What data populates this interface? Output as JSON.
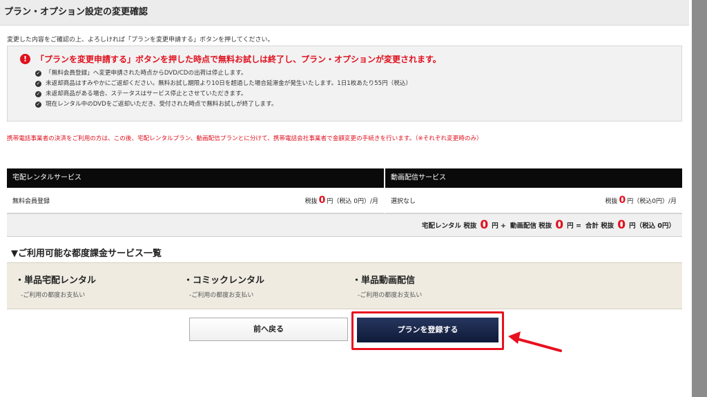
{
  "page": {
    "title": "プラン・オプション設定の変更確認",
    "intro": "変更した内容をご確認の上、よろしければ「プランを変更申請する」ボタンを押してください。"
  },
  "notice": {
    "heading": "「プランを変更申請する」ボタンを押した時点で無料お試しは終了し、プラン・オプションが変更されます。",
    "items": [
      "「無料会員登録」へ変更申請された時点からDVD/CDの出荷は停止します。",
      "未返却商品はすみやかにご返却ください。無料お試し期限より10日を超過した場合延滞金が発生いたします。1日1枚あたり55円（税込）",
      "未返却商品がある場合、ステータスはサービス停止とさせていただきます。",
      "現在レンタル中のDVDをご返却いただき、受付された時点で無料お試しが終了します。"
    ]
  },
  "carrier_note": "携帯電話事業者の決済をご利用の方は、この後、宅配レンタルプラン、動画配信プランとに分けて、携帯電話会社事業者で金額変更の手続きを行います。（※それぞれ変更時のみ）",
  "services": {
    "rental": {
      "header": "宅配レンタルサービス",
      "plan": "無料会員登録",
      "price_prefix": "税抜",
      "price": "0",
      "price_suffix": "円（税込 0円）/月"
    },
    "streaming": {
      "header": "動画配信サービス",
      "plan": "選択なし",
      "price_prefix": "税抜",
      "price": "0",
      "price_suffix": "円（税込0円）/月"
    }
  },
  "total": {
    "rental_label": "宅配レンタル 税抜",
    "rental_value": "0",
    "plus": "円 +",
    "streaming_label": "動画配信 税抜",
    "streaming_value": "0",
    "equals": "円 =",
    "total_label": "合計 税抜",
    "total_value": "0",
    "total_suffix": "円（税込 0円）"
  },
  "ppv": {
    "title": "▼ご利用可能な都度課金サービス一覧",
    "items": [
      {
        "name": "・単品宅配レンタル",
        "sub": "-ご利用の都度お支払い"
      },
      {
        "name": "・コミックレンタル",
        "sub": "-ご利用の都度お支払い"
      },
      {
        "name": "・単品動画配信",
        "sub": "-ご利用の都度お支払い"
      }
    ]
  },
  "buttons": {
    "back": "前へ戻る",
    "submit": "プランを登録する"
  },
  "colors": {
    "alert_red": "#e0101e",
    "submit_navy": "#1b2a50",
    "highlight_red": "#e8101e"
  }
}
